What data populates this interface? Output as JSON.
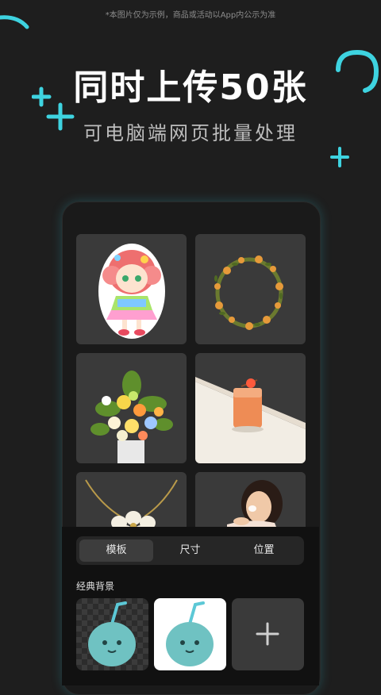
{
  "disclaimer": "*本图片仅为示例，商品或活动以App内公示为准",
  "headline": "同时上传50张",
  "subline": "可电脑端网页批量处理",
  "accent_color": "#3ed3e0",
  "grid": {
    "tiles": [
      {
        "icon": "anime-girl-sticker"
      },
      {
        "icon": "flower-wreath"
      },
      {
        "icon": "flower-bouquet"
      },
      {
        "icon": "orange-drink-glass"
      },
      {
        "icon": "pearl-flower-necklace"
      },
      {
        "icon": "woman-portrait"
      }
    ]
  },
  "editor": {
    "tabs": [
      {
        "label": "模板",
        "active": true
      },
      {
        "label": "尺寸",
        "active": false
      },
      {
        "label": "位置",
        "active": false
      }
    ],
    "section_title": "经典背景",
    "add_symbol": "+"
  }
}
